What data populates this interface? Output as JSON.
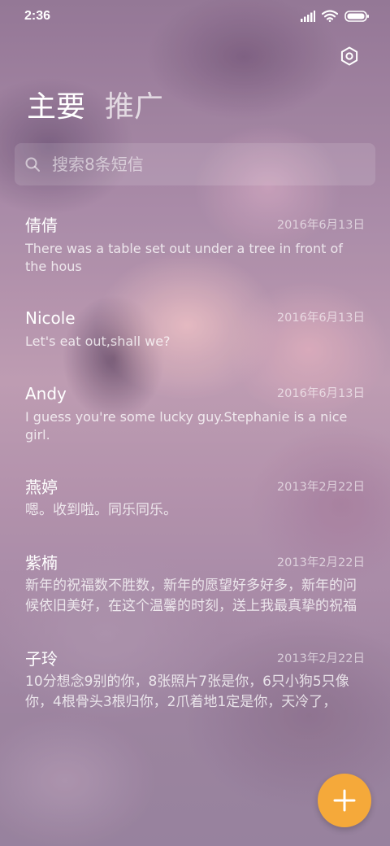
{
  "status_bar": {
    "time": "2:36"
  },
  "header": {
    "tabs": [
      {
        "label": "主要",
        "active": true
      },
      {
        "label": "推广",
        "active": false
      }
    ]
  },
  "search": {
    "placeholder": "搜索8条短信"
  },
  "conversations": [
    {
      "name": "倩倩",
      "date": "2016年6月13日",
      "preview": "There was a table set out under a tree in front of the hous"
    },
    {
      "name": "Nicole",
      "date": "2016年6月13日",
      "preview": "Let's eat out,shall we?"
    },
    {
      "name": "Andy",
      "date": "2016年6月13日",
      "preview": "I guess you're some lucky guy.Stephanie is a nice girl."
    },
    {
      "name": "燕婷",
      "date": "2013年2月22日",
      "preview": "嗯。收到啦。同乐同乐。"
    },
    {
      "name": "紫楠",
      "date": "2013年2月22日",
      "preview": "新年的祝福数不胜数，新年的愿望好多好多，新年的问候依旧美好，在这个温馨的时刻，送上我最真挚的祝福"
    },
    {
      "name": "子玲",
      "date": "2013年2月22日",
      "preview": "10分想念9别的你，8张照片7张是你，6只小狗5只像你，4根骨头3根归你，2爪着地1定是你，天冷了，"
    }
  ],
  "colors": {
    "fab": "#f5a93a",
    "text": "#ffffff"
  },
  "icons": {
    "settings": "gear-icon",
    "search": "search-icon",
    "fab": "plus-icon"
  }
}
